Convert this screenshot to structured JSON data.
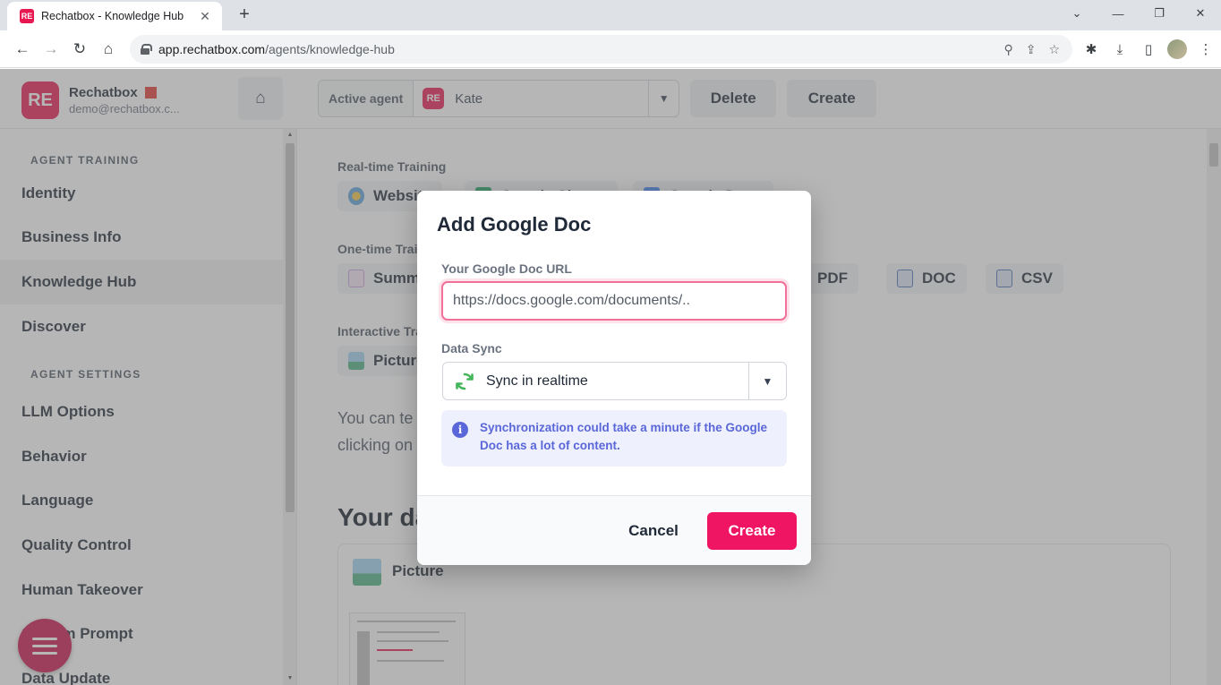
{
  "browser": {
    "tab_title": "Rechatbox - Knowledge Hub",
    "url_host": "app.rechatbox.com",
    "url_path": "/agents/knowledge-hub"
  },
  "app": {
    "brand_name": "Rechatbox",
    "account_email": "demo@rechatbox.c...",
    "active_agent_label": "Active agent",
    "active_agent_value": "Kate",
    "delete_label": "Delete",
    "create_label": "Create"
  },
  "sidebar": {
    "section_training": "AGENT TRAINING",
    "training_items": [
      "Identity",
      "Business Info",
      "Knowledge Hub",
      "Discover"
    ],
    "section_settings": "AGENT SETTINGS",
    "settings_items": [
      "LLM Options",
      "Behavior",
      "Language",
      "Quality Control",
      "Human Takeover",
      "System Prompt",
      "Data Update"
    ],
    "active_item": "Knowledge Hub"
  },
  "main": {
    "realtime_label": "Real-time Training",
    "realtime_chips": [
      "Website",
      "Google Sheets",
      "Google Docs"
    ],
    "onetime_label": "One-time Training",
    "onetime_chips": [
      "Summary",
      "PDF",
      "DOC",
      "CSV"
    ],
    "interactive_label": "Interactive Training",
    "interactive_chips": [
      "Picture"
    ],
    "intro_line1": "You can te",
    "intro_line2": "clicking on",
    "your_data_title": "Your data",
    "card_title": "Picture"
  },
  "modal": {
    "title": "Add Google Doc",
    "url_label": "Your Google Doc URL",
    "url_placeholder": "https://docs.google.com/documents/..",
    "sync_label": "Data Sync",
    "sync_value": "Sync in realtime",
    "info_text": "Synchronization could take a minute if the Google Doc has a lot of content.",
    "cancel_label": "Cancel",
    "create_label": "Create"
  },
  "colors": {
    "brand": "#e8174f",
    "primary_button": "#f01562",
    "info_text": "#5a67d8",
    "info_bg": "#eef0fe"
  }
}
